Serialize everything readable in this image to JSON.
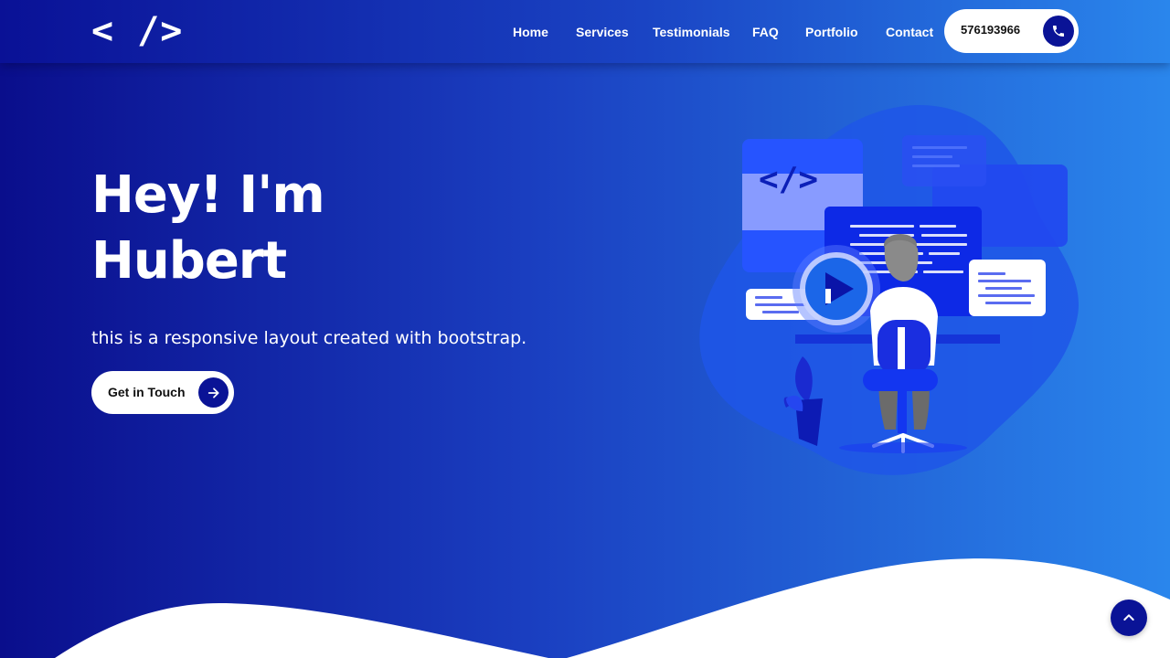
{
  "header": {
    "logo": "< />",
    "nav": [
      {
        "label": "Home",
        "name": "nav-home"
      },
      {
        "label": "Services",
        "name": "nav-services"
      },
      {
        "label": "Testimonials",
        "name": "nav-testimonials"
      },
      {
        "label": "FAQ",
        "name": "nav-faq"
      },
      {
        "label": "Portfolio",
        "name": "nav-portfolio"
      },
      {
        "label": "Contact",
        "name": "nav-contact"
      }
    ],
    "phone": "576193966",
    "phone_icon": "phone-icon"
  },
  "hero": {
    "title_line1": "Hey! I'm",
    "title_line2": "Hubert",
    "subtitle": "this is a responsive layout created with bootstrap.",
    "cta_label": "Get in Touch",
    "cta_icon": "arrow-right-icon",
    "illustration_code_tag": "</>",
    "illustration_icon": "play-icon"
  },
  "scroll_top_icon": "chevron-up-icon",
  "colors": {
    "primary_dark": "#0a1396",
    "gradient_start": "#0a0e8c",
    "gradient_end": "#2a86ec",
    "white": "#ffffff"
  }
}
